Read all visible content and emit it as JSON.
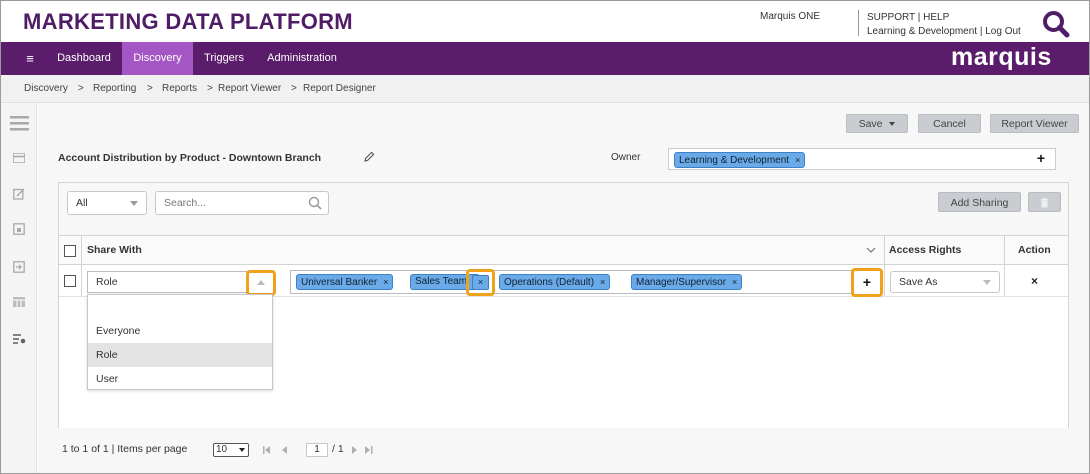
{
  "header": {
    "brand": "MARKETING DATA PLATFORM",
    "user": "Marquis ONE",
    "support": "SUPPORT",
    "help": "HELP",
    "org": "Learning & Development",
    "logout": "Log Out",
    "separator": "|"
  },
  "nav": {
    "menu_glyph": "≡",
    "items": [
      "Dashboard",
      "Discovery",
      "Triggers",
      "Administration"
    ],
    "active": "Discovery",
    "logo": "marquis"
  },
  "breadcrumb": [
    "Discovery",
    ">",
    "Reporting",
    ">",
    "Reports",
    ">",
    "Report Viewer",
    ">",
    "Report Designer"
  ],
  "toolbar": {
    "save": "Save",
    "cancel": "Cancel",
    "viewer": "Report Viewer"
  },
  "report": {
    "title": "Account Distribution by Product - Downtown Branch",
    "owner_label": "Owner",
    "owner_chip": "Learning & Development"
  },
  "filter": {
    "value": "All",
    "search_placeholder": "Search...",
    "add_sharing": "Add Sharing"
  },
  "grid": {
    "headers": {
      "share_with": "Share With",
      "access_rights": "Access Rights",
      "action": "Action"
    },
    "row": {
      "type": "Role",
      "chips": [
        "Universal Banker",
        "Sales Team",
        "Operations (Default)",
        "Manager/Supervisor"
      ],
      "access": "Save As",
      "action_glyph": "×"
    },
    "dropdown": [
      "Everyone",
      "Role",
      "User"
    ],
    "dropdown_selected": "Role"
  },
  "pager": {
    "summary": "1 to 1 of 1 | Items per page",
    "per_page": "10",
    "page": "1",
    "total": "/ 1"
  },
  "colors": {
    "brand": "#4f1c66",
    "nav": "#5b1d6b",
    "nav_active": "#a356c4",
    "chip": "#6aaae8",
    "highlight": "#f0a21a"
  }
}
